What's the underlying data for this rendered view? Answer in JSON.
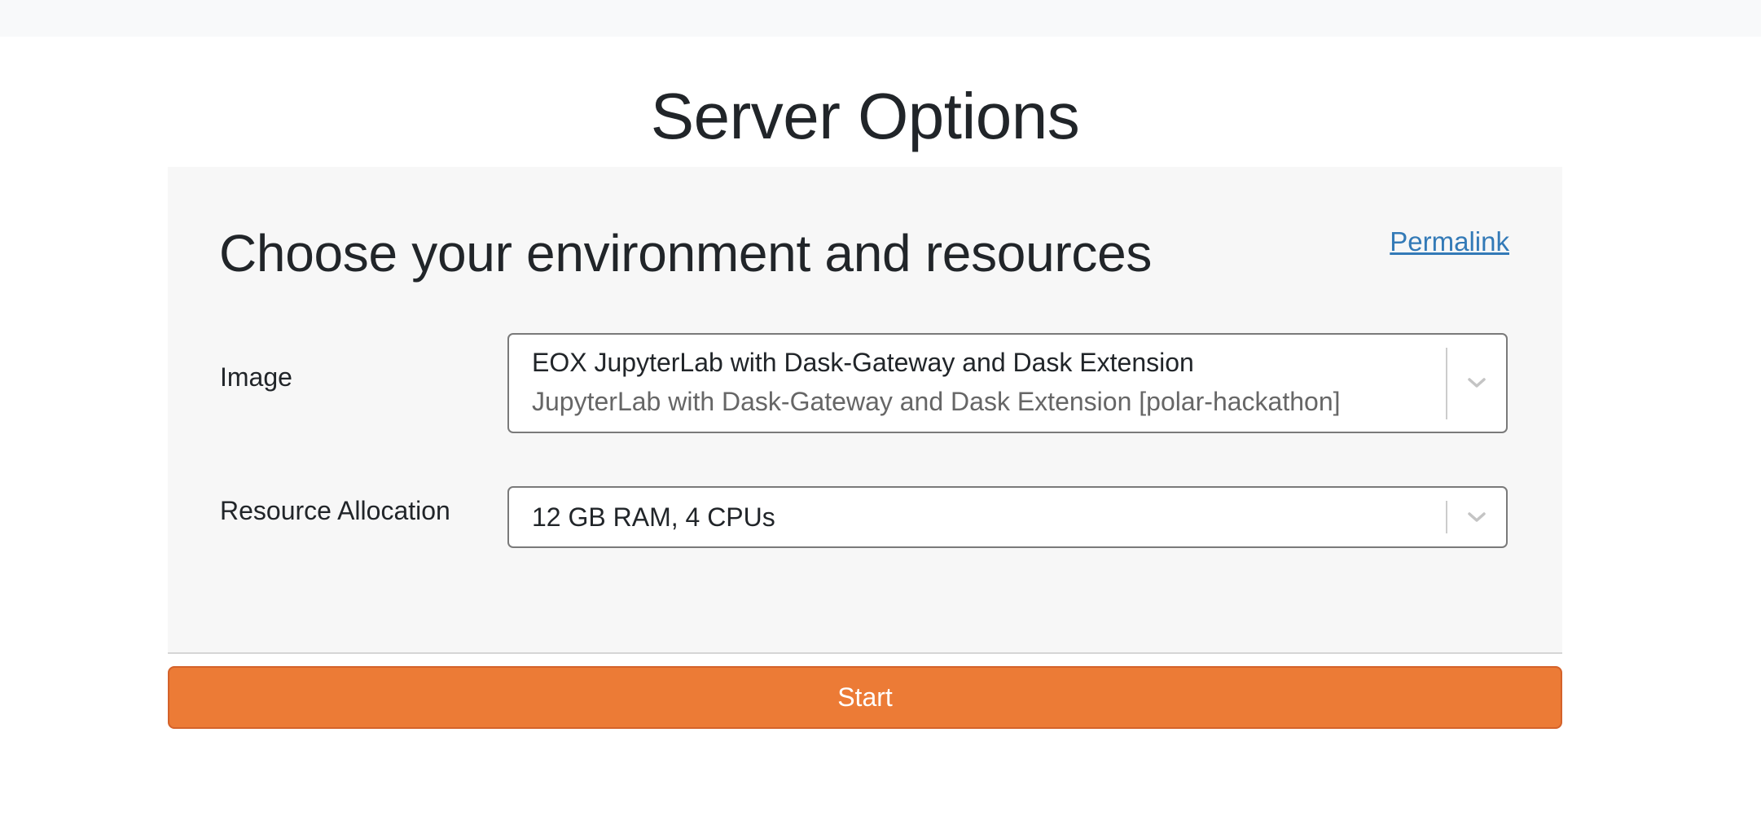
{
  "page": {
    "title": "Server Options"
  },
  "panel": {
    "heading": "Choose your environment and resources",
    "permalink_label": "Permalink"
  },
  "fields": {
    "image": {
      "label": "Image",
      "selected_title": "EOX JupyterLab with Dask-Gateway and Dask Extension",
      "selected_description": "JupyterLab with Dask-Gateway and Dask Extension [polar-hackathon]"
    },
    "resource": {
      "label": "Resource Allocation",
      "selected_value": "12 GB RAM, 4 CPUs"
    }
  },
  "actions": {
    "start_label": "Start"
  },
  "icons": {
    "dropdown": "chevron-down-icon"
  },
  "colors": {
    "accent": "#ec7b36",
    "link": "#337ab7",
    "panel_background": "#f7f7f7",
    "top_bar": "#f8f9fa"
  }
}
